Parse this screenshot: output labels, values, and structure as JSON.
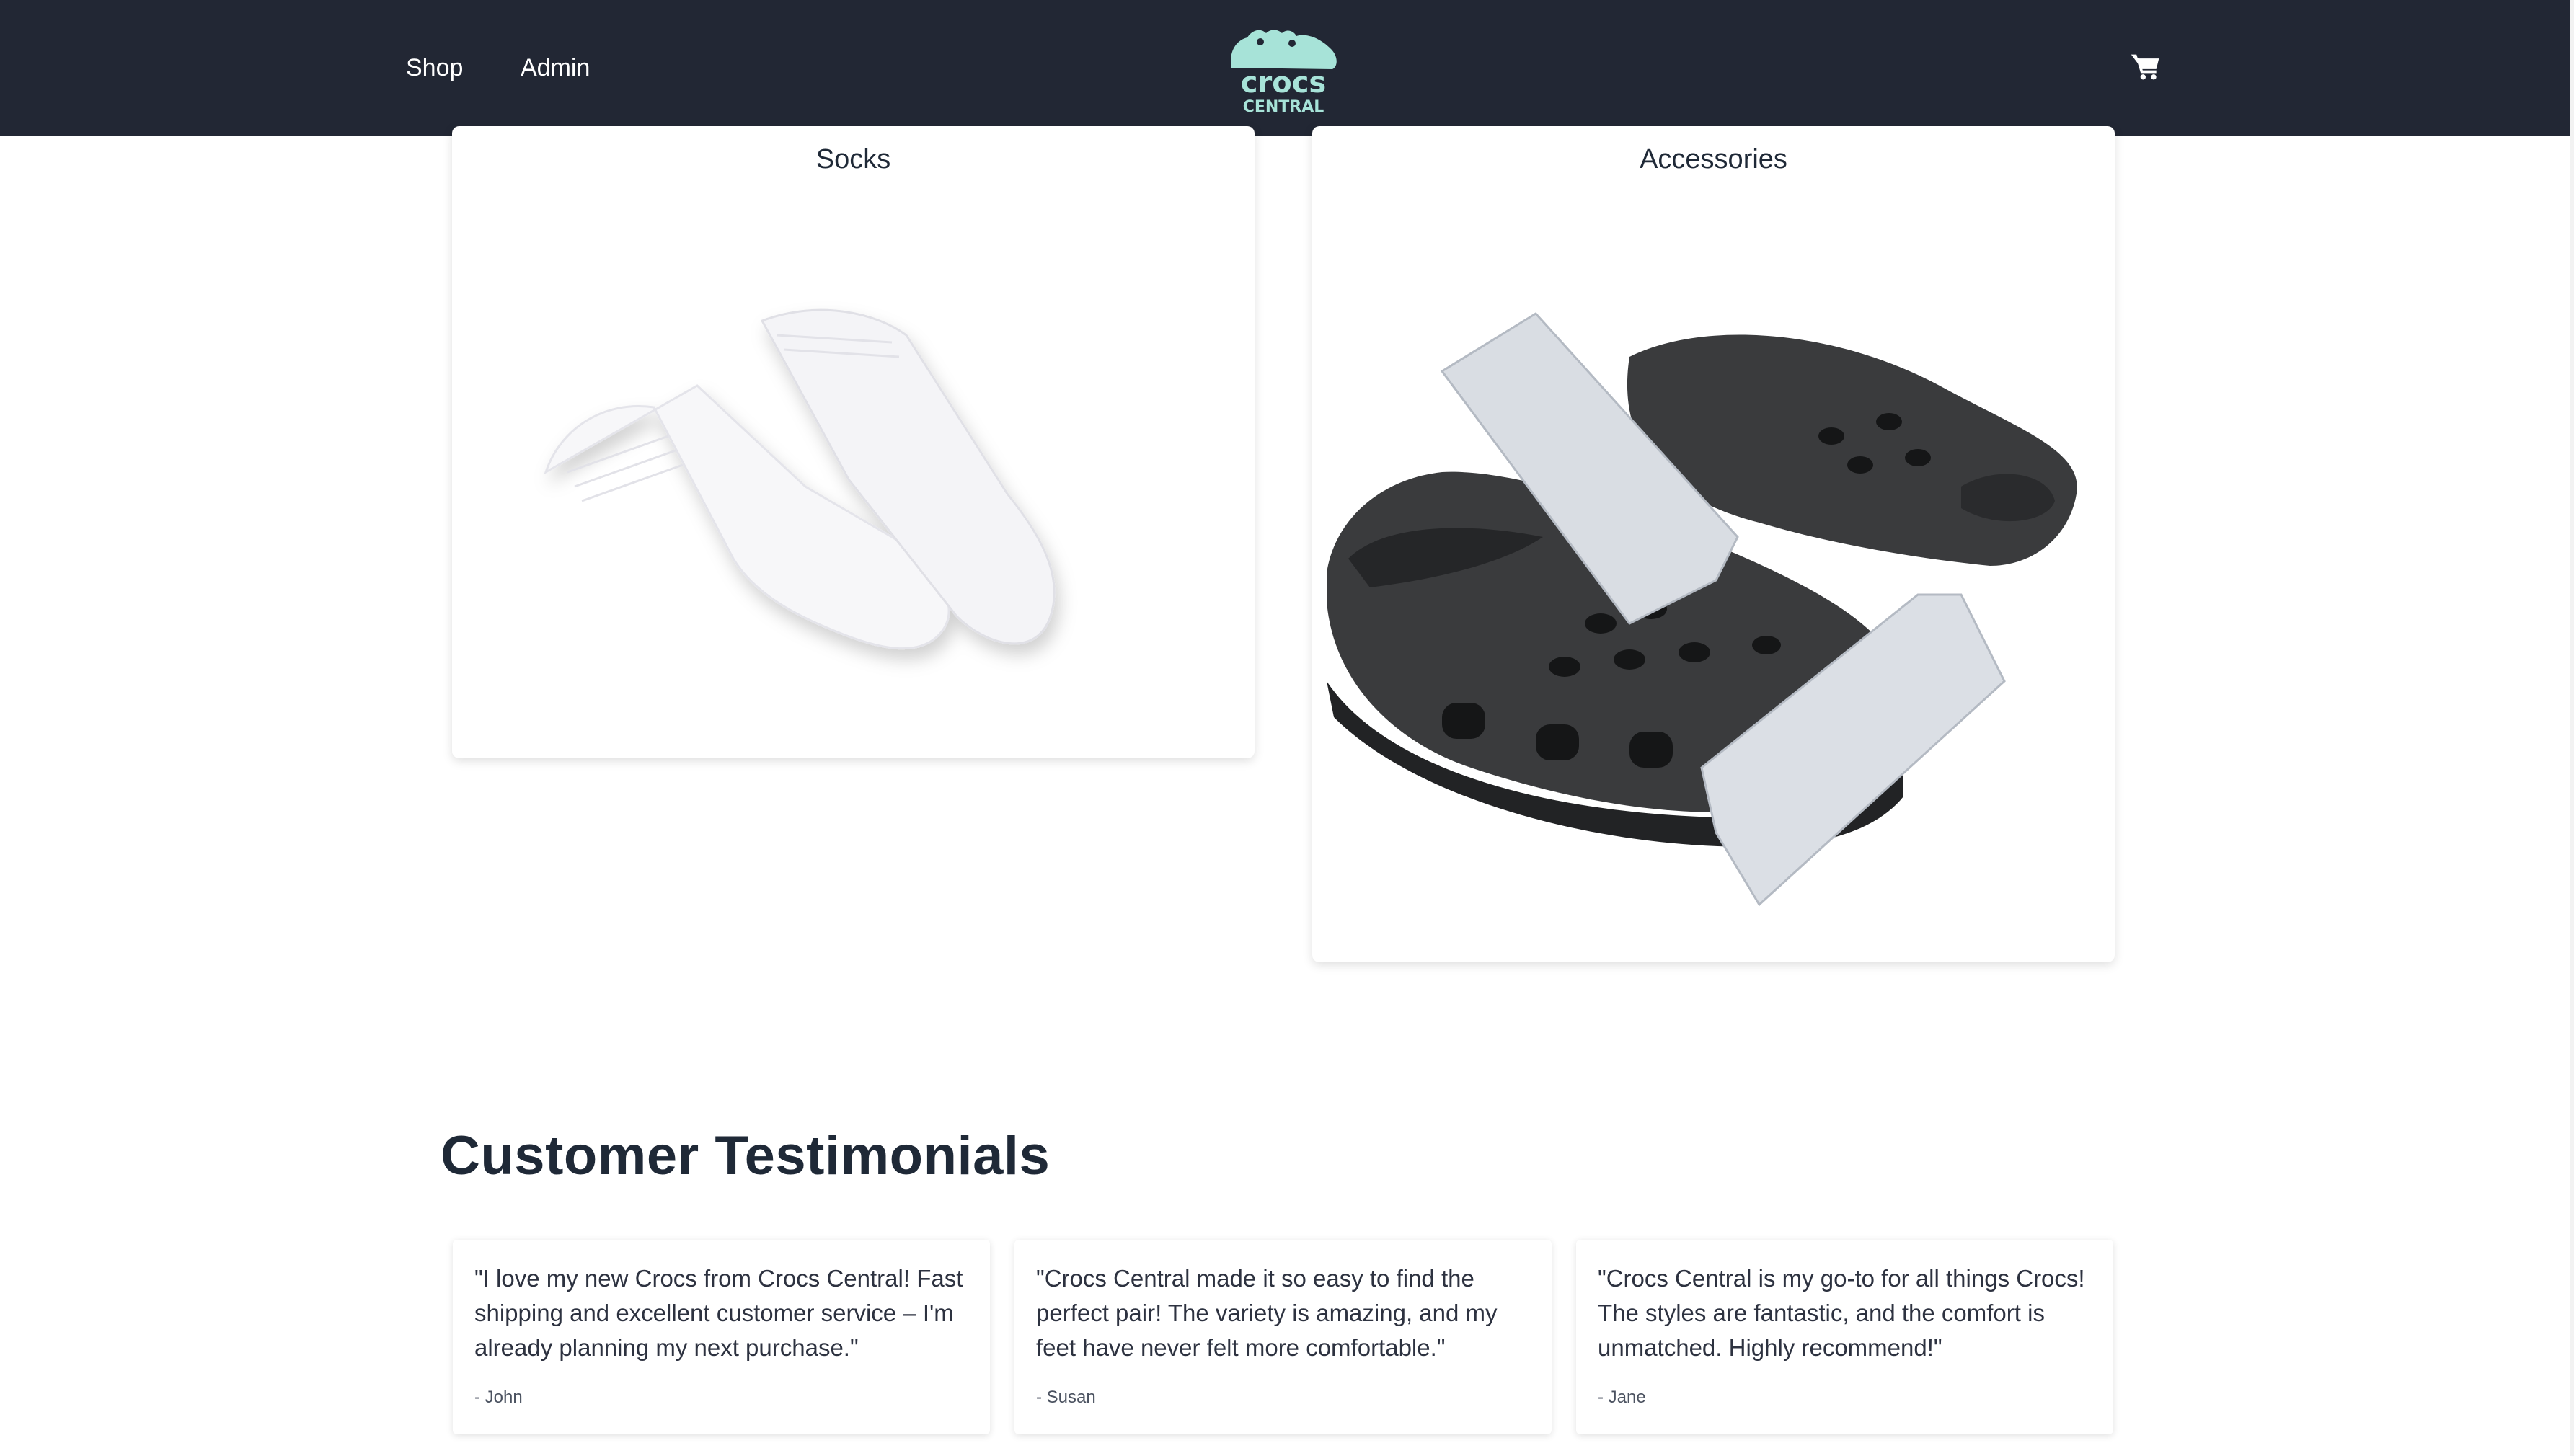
{
  "nav": {
    "links": [
      "Shop",
      "Admin"
    ],
    "logo": {
      "word": "crocs",
      "subword": "CENTRAL",
      "color": "#a7e3d8"
    },
    "cart_icon": "shopping-cart-icon",
    "background": "#222734"
  },
  "categories": [
    {
      "title": "Socks"
    },
    {
      "title": "Accessories"
    }
  ],
  "testimonials": {
    "heading": "Customer Testimonials",
    "items": [
      {
        "quote": "\"I love my new Crocs from Crocs Central! Fast shipping and excellent customer service – I'm already planning my next purchase.\"",
        "author": "- John"
      },
      {
        "quote": "\"Crocs Central made it so easy to find the perfect pair! The variety is amazing, and my feet have never felt more comfortable.\"",
        "author": "- Susan"
      },
      {
        "quote": "\"Crocs Central is my go-to for all things Crocs! The styles are fantastic, and the comfort is unmatched. Highly recommend!\"",
        "author": "- Jane"
      }
    ]
  }
}
